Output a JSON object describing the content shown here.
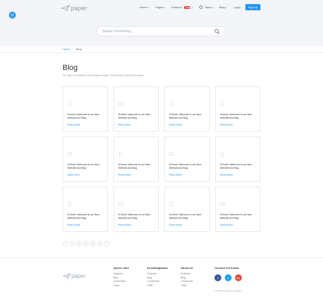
{
  "brand": {
    "name": "paper"
  },
  "nav": {
    "items": [
      {
        "label": "Home",
        "has_chevron": true
      },
      {
        "label": "Pages",
        "has_chevron": true
      },
      {
        "label": "Features",
        "badge": "NEW"
      },
      {
        "label": "Skins",
        "has_chevron": true
      },
      {
        "label": "Blog",
        "has_chevron": true
      },
      {
        "label": "Login"
      }
    ],
    "signup_label": "Sign Up"
  },
  "search": {
    "placeholder": "Search Something..."
  },
  "breadcrumb": {
    "home": "Home",
    "current": "Blog"
  },
  "page": {
    "title": "Blog",
    "subtitle": "Sed eget orci eleifend, tincid mattis suscipit. Suspendisse potenti consequat."
  },
  "cards": [
    {
      "title": "Hi there! Welcome to our New Website and Blog",
      "link": "Read Article",
      "icon": "document-icon"
    },
    {
      "title": "Hi there! Welcome to our New Website and Blog",
      "link": "Watch Now",
      "icon": "video-icon"
    },
    {
      "title": "Hi there! Welcome to our New Website and Blog",
      "link": "Read Article",
      "icon": "document-icon"
    },
    {
      "title": "Hi there! Welcome to our New Website and Blog",
      "link": "Read Article",
      "icon": "document-icon"
    },
    {
      "title": "Hi there! Welcome to our New Website and Blog",
      "link": "Watch Now",
      "icon": "video-icon"
    },
    {
      "title": "Hi there! Welcome to our New Website and Blog",
      "link": "Read Article",
      "icon": "document-icon"
    },
    {
      "title": "Hi there! Welcome to our New Website and Blog",
      "link": "Read Article",
      "icon": "image-icon"
    },
    {
      "title": "Hi there! Welcome to our New Website and Blog",
      "link": "Read Article",
      "icon": "document-icon"
    },
    {
      "title": "Hi there! Welcome to our New Website and Blog",
      "link": "Read Article",
      "icon": "document-icon"
    },
    {
      "title": "Hi there! Welcome to our New Website and Blog",
      "link": "Read Article",
      "icon": "image-icon"
    },
    {
      "title": "Hi there! Welcome to our New Website and Blog",
      "link": "Read Article",
      "icon": "document-icon"
    },
    {
      "title": "Hi there! Welcome to our New Website and Blog",
      "link": "Read Article",
      "icon": "image-icon"
    }
  ],
  "pagination": {
    "prev": "‹",
    "pages": [
      "1",
      "2",
      "3",
      "4",
      "5"
    ],
    "next": "›",
    "active": "1"
  },
  "footer": {
    "quick_links": {
      "heading": "Quick Links",
      "items": [
        "Features",
        "Blog",
        "Community",
        "Login"
      ]
    },
    "knowledgebase": {
      "heading": "Knowledgebase",
      "items": [
        "Features",
        "Blog",
        "Community",
        "Login"
      ]
    },
    "about": {
      "heading": "About Us",
      "items": [
        "Features",
        "Blog",
        "Community",
        "Login"
      ]
    },
    "social": {
      "heading": "Connect via Social",
      "networks": [
        {
          "name": "facebook",
          "glyph": "f",
          "color": "#3b5998"
        },
        {
          "name": "twitter",
          "glyph": "t",
          "color": "#1da1f2"
        },
        {
          "name": "google-plus",
          "glyph": "G+",
          "color": "#dd4b39"
        }
      ]
    },
    "copyright": "© 2018 Knowledge Copyright"
  },
  "colors": {
    "accent": "#2196f3",
    "hero_bg": "#f3f5f8",
    "badge": "#e53935"
  }
}
